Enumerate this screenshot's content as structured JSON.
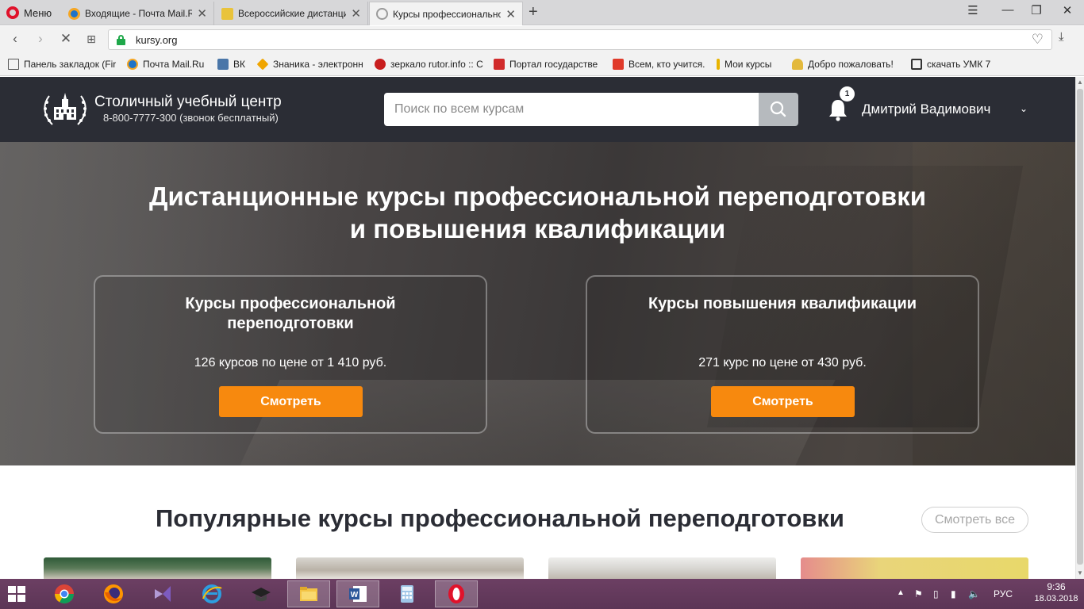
{
  "browser": {
    "menu_label": "Меню",
    "tabs": [
      {
        "title": "Входящие - Почта Mail.Ru",
        "close": "✕"
      },
      {
        "title": "Всероссийские дистанционн",
        "close": "✕"
      },
      {
        "title": "Курсы профессиональной",
        "close": "✕"
      }
    ],
    "new_tab": "+",
    "url": "kursy.org"
  },
  "bookmarks": [
    {
      "label": "Панель закладок (Fir",
      "color": "#555555"
    },
    {
      "label": "Почта Mail.Ru",
      "color": "#1e73c8"
    },
    {
      "label": "ВК",
      "color": "#4a76a8"
    },
    {
      "label": "Знаника - электронн",
      "color": "#f0a500"
    },
    {
      "label": "зеркало rutor.info :: С",
      "color": "#c81e1e"
    },
    {
      "label": "Портал государстве",
      "color": "#d12b2b"
    },
    {
      "label": "Всем, кто учится.",
      "color": "#e03a2a"
    },
    {
      "label": "Мои курсы",
      "color": "#e8b400"
    },
    {
      "label": "Добро пожаловать!",
      "color": "#e3b93c"
    },
    {
      "label": "скачать УМК 7",
      "color": "#333333"
    }
  ],
  "site": {
    "brand_name": "Столичный учебный центр",
    "brand_phone": "8-800-7777-300 (звонок бесплатный)",
    "search_placeholder": "Поиск по всем курсам",
    "notification_count": "1",
    "user_name": "Дмитрий Вадимович",
    "user_chevron": "⌄"
  },
  "hero": {
    "title_line1": "Дистанционные курсы профессиональной переподготовки",
    "title_line2": "и повышения квалификации",
    "cards": [
      {
        "title": "Курсы профессиональной переподготовки",
        "info": "126 курсов по цене от 1 410 руб.",
        "button": "Смотреть"
      },
      {
        "title": "Курсы повышения квалификации",
        "info": "271 курс по цене от 430 руб.",
        "button": "Смотреть"
      }
    ]
  },
  "popular": {
    "title": "Популярные курсы профессиональной переподготовки",
    "see_all": "Смотреть все"
  },
  "taskbar": {
    "language": "РУС",
    "time": "9:36",
    "date": "18.03.2018"
  },
  "colors": {
    "header_bg": "#2b2d35",
    "accent_orange": "#f7890e",
    "taskbar_bg": "#6c3f63"
  }
}
